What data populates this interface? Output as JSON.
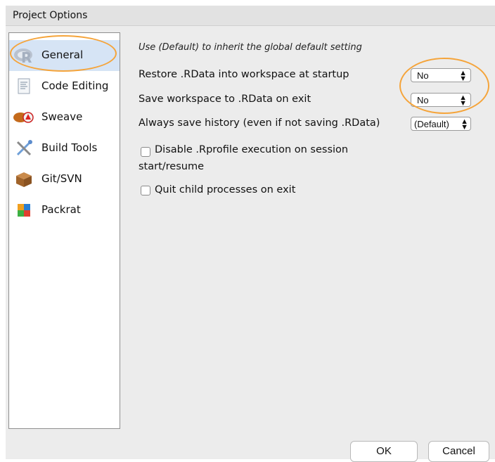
{
  "window": {
    "title": "Project Options"
  },
  "sidebar": {
    "items": [
      {
        "label": "General",
        "icon": "r-logo-icon"
      },
      {
        "label": "Code Editing",
        "icon": "document-icon"
      },
      {
        "label": "Sweave",
        "icon": "sweave-icon"
      },
      {
        "label": "Build Tools",
        "icon": "tools-icon"
      },
      {
        "label": "Git/SVN",
        "icon": "package-box-icon"
      },
      {
        "label": "Packrat",
        "icon": "packrat-icon"
      }
    ]
  },
  "general": {
    "hint": "Use (Default) to inherit the global default setting",
    "restore_label": "Restore .RData into workspace at startup",
    "restore_value": "No",
    "save_label": "Save workspace to .RData on exit",
    "save_value": "No",
    "history_label": "Always save history (even if not saving .RData)",
    "history_value": "(Default)",
    "disable_rprofile_line1": "Disable .Rprofile execution on session",
    "disable_rprofile_line2": "start/resume",
    "quit_child_label": "Quit child processes on exit"
  },
  "buttons": {
    "ok": "OK",
    "cancel": "Cancel"
  },
  "colors": {
    "highlight": "#f5a43a",
    "selection": "#d6e4f5"
  }
}
